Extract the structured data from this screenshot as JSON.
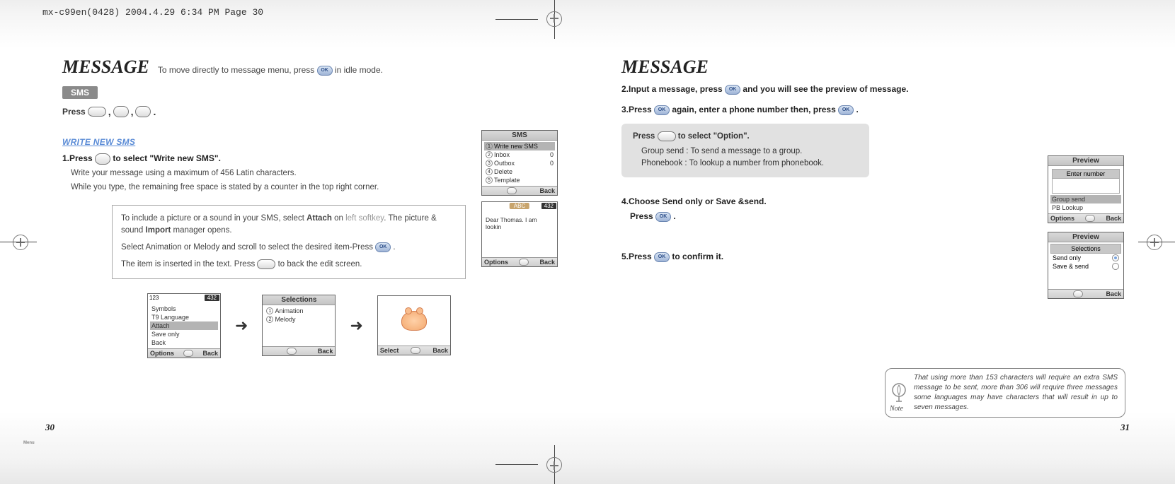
{
  "top_meta": "mx-c99en(0428)  2004.4.29  6:34 PM  Page 30",
  "left": {
    "title": "MESSAGE",
    "subtitle": "To move directly to message menu, press        in idle mode.",
    "sms_tab": "SMS",
    "press_label": "Press",
    "press_sublabel": "Menu",
    "write_new_sms_head": "WRITE NEW SMS",
    "step1": "1.Press          to select \"Write new SMS\".",
    "step1_body1": "Write your message using a maximum of 456 Latin characters.",
    "step1_body2": "While you type, the remaining free space is stated by a counter in the top right corner.",
    "tip_line1a": "To include a picture or a sound in your SMS, select ",
    "tip_line1b": "Attach",
    "tip_line1c": " on ",
    "tip_line1d": "left softkey",
    "tip_line1e": ". The picture & sound ",
    "tip_line1f": "Import",
    "tip_line1g": " manager opens.",
    "tip_line2": "Select Animation or Melody and scroll to select the desired item-Press ",
    "tip_line3": "The item is inserted in the text. Press          to back the edit screen.",
    "page_num": "30",
    "phone_sms": {
      "title": "SMS",
      "items": [
        {
          "n": "1",
          "label": "Write new SMS",
          "badge": ""
        },
        {
          "n": "2",
          "label": "Inbox",
          "badge": "0"
        },
        {
          "n": "3",
          "label": "Outbox",
          "badge": "0"
        },
        {
          "n": "4",
          "label": "Delete",
          "badge": ""
        },
        {
          "n": "5",
          "label": "Template",
          "badge": ""
        }
      ],
      "foot_r": "Back"
    },
    "phone_editor": {
      "counter": "432",
      "abc": "ABC",
      "text": "Dear Thomas. I am lookin",
      "foot_l": "Options",
      "foot_r": "Back"
    },
    "flow": {
      "menu": {
        "head_left": "123",
        "counter": "432",
        "items": [
          "Symbols",
          "T9 Language",
          "Attach",
          "Save only",
          "Back"
        ],
        "hl_index": 2,
        "foot_l": "Options",
        "foot_r": "Back"
      },
      "selections": {
        "title": "Selections",
        "items": [
          {
            "n": "1",
            "label": "Animation"
          },
          {
            "n": "2",
            "label": "Melody"
          }
        ],
        "foot_r": "Back"
      },
      "preview": {
        "foot_l": "Select",
        "foot_r": "Back"
      }
    }
  },
  "right": {
    "title": "MESSAGE",
    "step2": "2.Input a message, press          and you will see the preview of message.",
    "step3": "3.Press          again, enter a phone number then, press          .",
    "graybox_head": "Press         to select \"Option\".",
    "graybox_line1": "Group send : To send a message to a group.",
    "graybox_line2": "Phonebook : To lookup a number from phonebook.",
    "step4_a": "4.Choose Send only or Save &send.",
    "step4_b": "Press          .",
    "step5": "5.Press          to confirm it.",
    "note": "That using more than 153 characters will require an extra SMS message to be sent, more than 306 will require three messages some languages may have characters that will result in up to seven messages.",
    "note_label": "Note",
    "page_num": "31",
    "phone_preview1": {
      "title": "Preview",
      "popup_title": "Enter number",
      "rows": [
        "Group send",
        "PB Lookup"
      ],
      "foot_l": "Options",
      "foot_r": "Back"
    },
    "phone_preview2": {
      "title": "Preview",
      "sub": "Selections",
      "rows": [
        "Send only",
        "Save & send"
      ],
      "foot_r": "Back"
    }
  },
  "ok_label": "OK"
}
